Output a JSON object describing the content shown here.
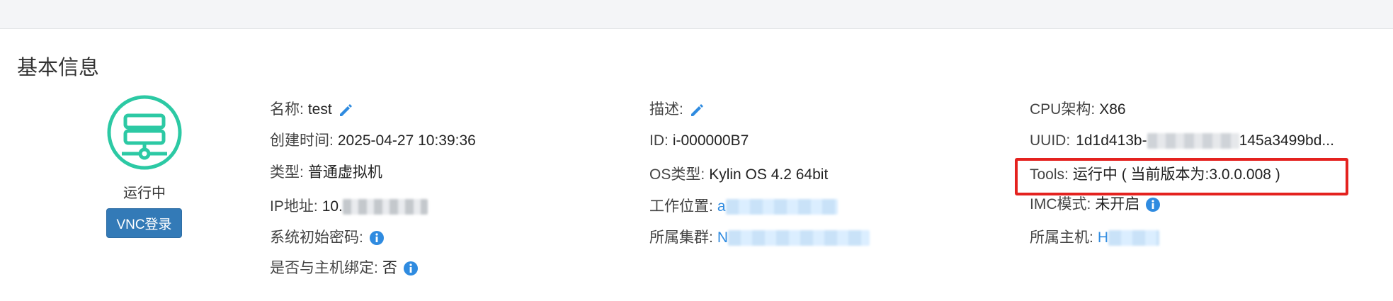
{
  "section_title": "基本信息",
  "status": "运行中",
  "vnc_button": "VNC登录",
  "col1": {
    "name_label": "名称:",
    "name_value": "test",
    "created_label": "创建时间:",
    "created_value": "2025-04-27 10:39:36",
    "type_label": "类型:",
    "type_value": "普通虚拟机",
    "ip_label": "IP地址:",
    "ip_value": "10.",
    "password_label": "系统初始密码:",
    "bind_label": "是否与主机绑定:",
    "bind_value": "否"
  },
  "col2": {
    "desc_label": "描述:",
    "id_label": "ID:",
    "id_value": "i-000000B7",
    "os_label": "OS类型:",
    "os_value": "Kylin OS 4.2 64bit",
    "location_label": "工作位置:",
    "location_value": "a",
    "cluster_label": "所属集群:",
    "cluster_value": "N"
  },
  "col3": {
    "cpu_label": "CPU架构:",
    "cpu_value": "X86",
    "uuid_label": "UUID:",
    "uuid_prefix": "1d1d413b-",
    "uuid_suffix": "145a3499bd...",
    "tools_label": "Tools:",
    "tools_value": "运行中 ( 当前版本为:3.0.0.008 )",
    "imc_label": "IMC模式:",
    "imc_value": "未开启",
    "host_label": "所属主机:",
    "host_value": "H"
  },
  "colors": {
    "accent": "#2f8be0",
    "vm_icon": "#2cc9a4",
    "button": "#337ab7",
    "highlight": "#e4221f"
  },
  "icons": [
    "vm-server-icon",
    "edit-icon",
    "info-icon"
  ]
}
